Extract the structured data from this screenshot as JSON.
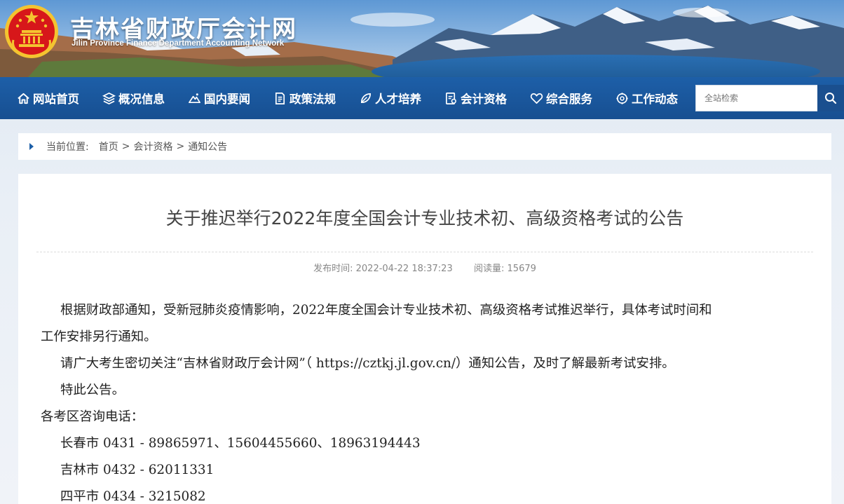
{
  "header": {
    "title": "吉林省财政厅会计网",
    "subtitle": "Jilin Province Finance Department Accounting Network"
  },
  "nav": {
    "items": [
      {
        "label": "网站首页",
        "icon": "home-icon"
      },
      {
        "label": "概况信息",
        "icon": "layers-icon"
      },
      {
        "label": "国内要闻",
        "icon": "mountain-icon"
      },
      {
        "label": "政策法规",
        "icon": "document-icon"
      },
      {
        "label": "人才培养",
        "icon": "leaf-icon"
      },
      {
        "label": "会计资格",
        "icon": "certificate-icon"
      },
      {
        "label": "综合服务",
        "icon": "heart-icon"
      },
      {
        "label": "工作动态",
        "icon": "gear-icon"
      }
    ],
    "search_placeholder": "全站检索"
  },
  "breadcrumb": {
    "prefix": "当前位置:",
    "items": [
      "首页",
      "会计资格",
      "通知公告"
    ],
    "separator": ">"
  },
  "article": {
    "title": "关于推迟举行2022年度全国会计专业技术初、高级资格考试的公告",
    "publish_label": "发布时间:",
    "publish_time": "2022-04-22 18:37:23",
    "views_label": "阅读量:",
    "views": "15679",
    "paragraphs": [
      "根据财政部通知，受新冠肺炎疫情影响，2022年度全国会计专业技术初、高级资格考试推迟举行，具体考试时间和",
      "工作安排另行通知。",
      "请广大考生密切关注“吉林省财政厅会计网”（ https://cztkj.jl.gov.cn/）通知公告，及时了解最新考试安排。",
      "特此公告。",
      "各考区咨询电话：",
      "长春市 0431 - 89865971、15604455660、18963194443",
      "吉林市 0432 - 62011331",
      "四平市 0434 - 3215082"
    ]
  },
  "colors": {
    "nav_bg": "#1d5fa8",
    "search_btn": "#1a4f8f",
    "emblem_red": "#d7171a",
    "emblem_gold": "#f4c430"
  }
}
